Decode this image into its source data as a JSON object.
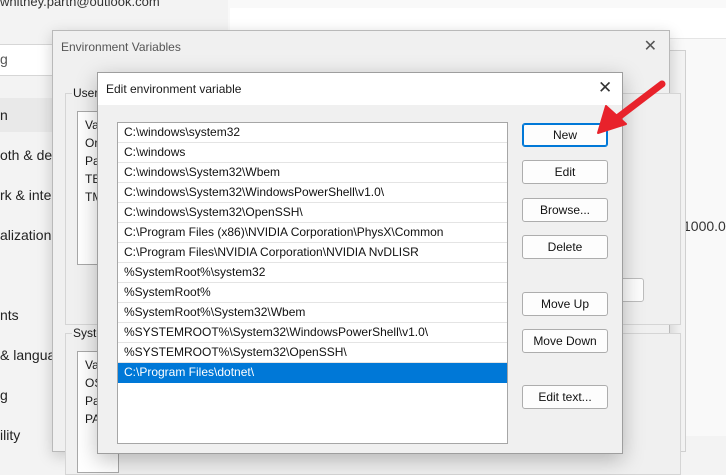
{
  "settings": {
    "email": "whitney.parth@outlook.com",
    "search_placeholder": "g",
    "nav_items": [
      {
        "label": "n"
      },
      {
        "label": "oth & de"
      },
      {
        "label": "rk & inte"
      },
      {
        "label": "alization"
      },
      {
        "label": "nts"
      },
      {
        "label": "& langua"
      },
      {
        "label": "g"
      },
      {
        "label": "ility"
      }
    ],
    "right_value": "1000.0"
  },
  "env_dialog": {
    "title": "Environment Variables",
    "close_glyph": "✕",
    "user_group_label": "User",
    "user_rows": [
      "Va",
      "Or",
      "Pa",
      "TE",
      "TM"
    ],
    "system_group_label": "Syste",
    "system_rows": [
      "Va",
      "OS",
      "Pa",
      "PA"
    ]
  },
  "edit_dialog": {
    "title": "Edit environment variable",
    "close_glyph": "✕",
    "paths": [
      "C:\\windows\\system32",
      "C:\\windows",
      "C:\\windows\\System32\\Wbem",
      "C:\\windows\\System32\\WindowsPowerShell\\v1.0\\",
      "C:\\windows\\System32\\OpenSSH\\",
      "C:\\Program Files (x86)\\NVIDIA Corporation\\PhysX\\Common",
      "C:\\Program Files\\NVIDIA Corporation\\NVIDIA NvDLISR",
      "%SystemRoot%\\system32",
      "%SystemRoot%",
      "%SystemRoot%\\System32\\Wbem",
      "%SYSTEMROOT%\\System32\\WindowsPowerShell\\v1.0\\",
      "%SYSTEMROOT%\\System32\\OpenSSH\\",
      "C:\\Program Files\\dotnet\\"
    ],
    "selected_index": 12,
    "buttons": {
      "new": "New",
      "edit": "Edit",
      "browse": "Browse...",
      "delete": "Delete",
      "move_up": "Move Up",
      "move_down": "Move Down",
      "edit_text": "Edit text..."
    }
  },
  "annotation": {
    "arrow_color": "#e8222b"
  }
}
